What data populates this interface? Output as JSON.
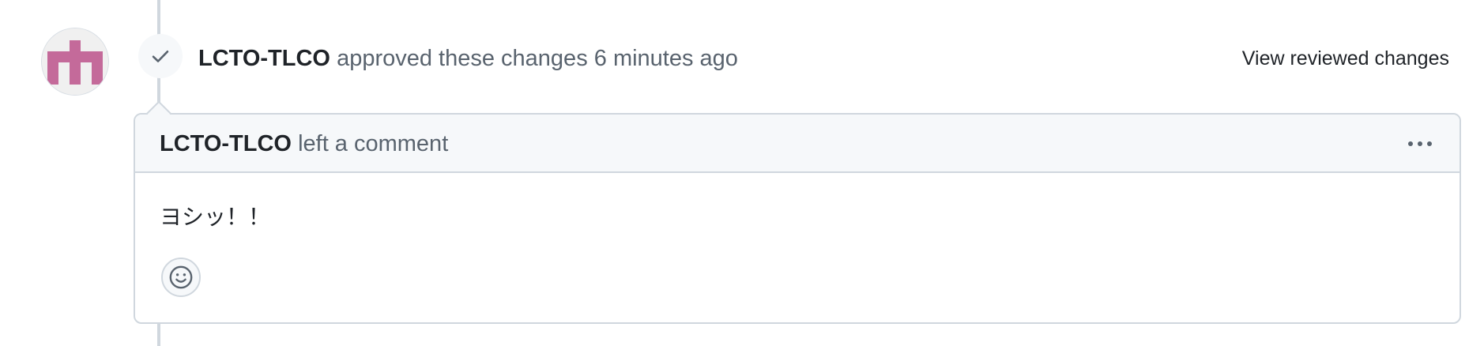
{
  "review_event": {
    "author": "LCTO-TLCO",
    "action_text": "approved these changes",
    "time_ago": "6 minutes ago",
    "view_changes_label": "View reviewed changes"
  },
  "comment": {
    "author": "LCTO-TLCO",
    "action_text": "left a comment",
    "body": "ヨシッ！！"
  },
  "icons": {
    "avatar": "identicon-avatar",
    "badge": "check-icon",
    "menu": "kebab-horizontal-icon",
    "reaction": "smiley-icon"
  },
  "colors": {
    "avatar_accent": "#c46a9a",
    "border": "#d0d7de",
    "muted_text": "#59636e",
    "header_bg": "#f6f8fa"
  }
}
